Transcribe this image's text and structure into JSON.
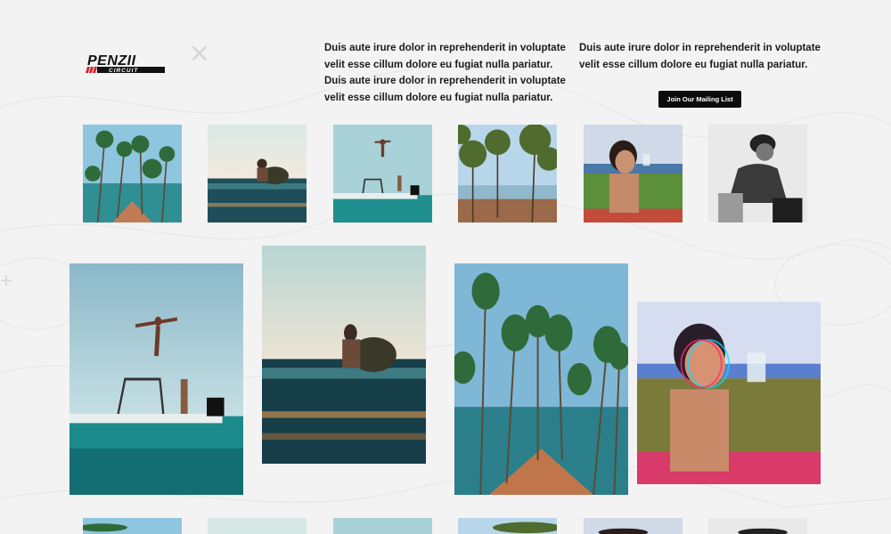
{
  "brand": {
    "line1": "PENZII",
    "line2": "CIRCUIT"
  },
  "intro": {
    "left_paragraph": "Duis aute irure dolor in reprehenderit in voluptate velit esse cillum dolore eu fugiat nulla pariatur. Duis aute irure dolor in reprehenderit in voluptate velit esse cillum dolore eu fugiat nulla pariatur.",
    "right_paragraph": "Duis aute irure dolor in reprehenderit in voluptate velit esse cillum dolore eu fugiat nulla pariatur."
  },
  "mailing_button": {
    "label": "Join Our Mailing List"
  },
  "gallery": {
    "thumbnails": [
      "palm-road",
      "surfer-sitting",
      "boat-jump",
      "lake-trees",
      "woman-drinking",
      "man-crouching"
    ],
    "featured": [
      "boat-jump",
      "surfer-sitting",
      "palm-road",
      "woman-drinking-glitch"
    ]
  },
  "colors": {
    "accent": "#0b0b0b",
    "logo_red": "#d1242a",
    "background": "#f3f3f3"
  }
}
